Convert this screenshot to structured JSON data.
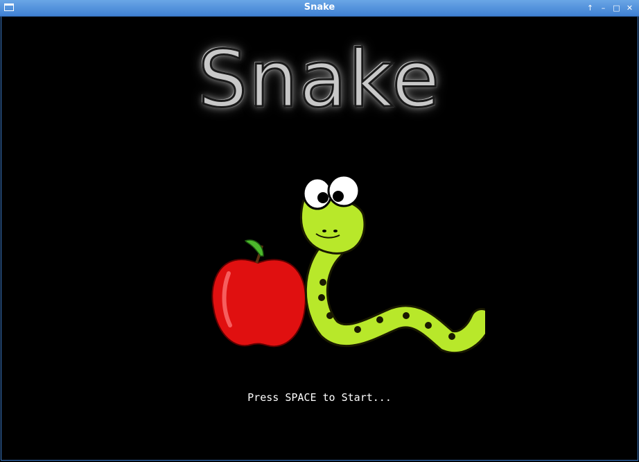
{
  "window": {
    "title": "Snake",
    "controls": [
      {
        "name": "pin-button",
        "glyph": "↑"
      },
      {
        "name": "minimize-button",
        "glyph": "–"
      },
      {
        "name": "maximize-button",
        "glyph": "□"
      },
      {
        "name": "close-button",
        "glyph": "✕"
      }
    ]
  },
  "screen": {
    "game_title": "Snake",
    "start_prompt": "Press SPACE to Start...",
    "artwork": [
      "apple-illustration",
      "snake-illustration"
    ]
  },
  "colors": {
    "titlebar": "#4a8ad8",
    "background": "#000000",
    "snake_body": "#b8e82a",
    "apple": "#e01010"
  }
}
